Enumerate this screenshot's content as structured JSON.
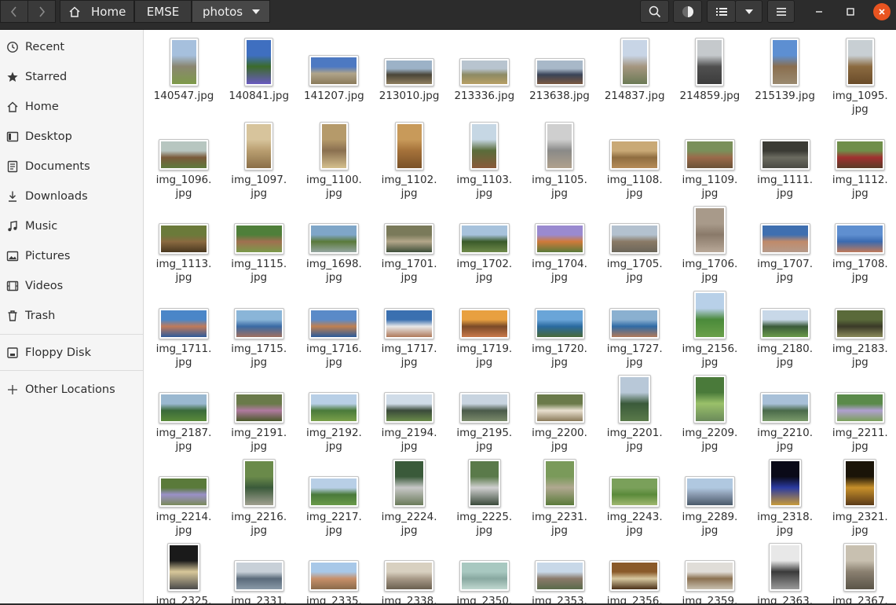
{
  "header": {
    "back_icon": "chevron-left-icon",
    "forward_icon": "chevron-right-icon",
    "breadcrumbs": [
      "Home",
      "EMSE",
      "photos"
    ],
    "buttons": [
      "search-icon",
      "progress-icon",
      "list-view-icon",
      "view-menu-caret-icon",
      "hamburger-menu-icon"
    ],
    "window_controls": [
      "minimize-icon",
      "maximize-icon",
      "close-icon"
    ],
    "close_color": "#e95420"
  },
  "sidebar": {
    "items": [
      {
        "label": "Recent",
        "icon": "clock-icon"
      },
      {
        "label": "Starred",
        "icon": "star-icon"
      },
      {
        "label": "Home",
        "icon": "home-icon"
      },
      {
        "label": "Desktop",
        "icon": "desktop-icon"
      },
      {
        "label": "Documents",
        "icon": "document-icon"
      },
      {
        "label": "Downloads",
        "icon": "download-icon"
      },
      {
        "label": "Music",
        "icon": "music-icon"
      },
      {
        "label": "Pictures",
        "icon": "pictures-icon"
      },
      {
        "label": "Videos",
        "icon": "video-icon"
      },
      {
        "label": "Trash",
        "icon": "trash-icon"
      },
      {
        "label": "Floppy Disk",
        "icon": "disk-icon"
      },
      {
        "label": "Other Locations",
        "icon": "plus-icon"
      }
    ]
  },
  "files": [
    {
      "name": "140547.jpg",
      "orient": "portrait",
      "colors": [
        "#a6c0dd",
        "#8a8670",
        "#7e9a4a"
      ]
    },
    {
      "name": "140841.jpg",
      "orient": "portrait",
      "colors": [
        "#3f6fc0",
        "#3b6b2a",
        "#6a5ac0"
      ]
    },
    {
      "name": "141207.jpg",
      "orient": "landscape",
      "colors": [
        "#4d79c2",
        "#b0a48a",
        "#8a7a5a"
      ]
    },
    {
      "name": "213010.jpg",
      "orient": "wide",
      "colors": [
        "#9cb2c7",
        "#4a4538",
        "#8f7e5f"
      ]
    },
    {
      "name": "213336.jpg",
      "orient": "wide",
      "colors": [
        "#b8c4cf",
        "#8d8a64",
        "#b8a065"
      ]
    },
    {
      "name": "213638.jpg",
      "orient": "wide",
      "colors": [
        "#a8b8c8",
        "#394357",
        "#7a5840"
      ]
    },
    {
      "name": "214837.jpg",
      "orient": "portrait",
      "colors": [
        "#c8d5e6",
        "#a59680",
        "#6b7a55"
      ]
    },
    {
      "name": "214859.jpg",
      "orient": "portrait",
      "colors": [
        "#c5c9cc",
        "#505050",
        "#3c3c3c"
      ]
    },
    {
      "name": "215139.jpg",
      "orient": "portrait",
      "colors": [
        "#5d8fd2",
        "#8a6e4e",
        "#9a8a70"
      ]
    },
    {
      "name": "img_1095.\njpg",
      "orient": "portrait",
      "colors": [
        "#c8cfd3",
        "#8b6a40",
        "#6a4c2a"
      ]
    },
    {
      "name": "img_1096.\njpg",
      "orient": "landscape",
      "colors": [
        "#b7c6c0",
        "#7a5a3a",
        "#5e7a3c"
      ]
    },
    {
      "name": "img_1097.\njpg",
      "orient": "portrait",
      "colors": [
        "#d7c49c",
        "#b99e70",
        "#8a6f48"
      ]
    },
    {
      "name": "img_1100.\njpg",
      "orient": "portrait",
      "colors": [
        "#b59a6a",
        "#8a7050",
        "#d4bf8d"
      ]
    },
    {
      "name": "img_1102.\njpg",
      "orient": "portrait",
      "colors": [
        "#c89a5a",
        "#a5723a",
        "#7a5228"
      ]
    },
    {
      "name": "img_1103.\njpg",
      "orient": "portrait",
      "colors": [
        "#c6d7e4",
        "#5a6c3a",
        "#8a5a3a"
      ]
    },
    {
      "name": "img_1105.\njpg",
      "orient": "portrait",
      "colors": [
        "#cfcfcf",
        "#8a8a88",
        "#b0a08c"
      ]
    },
    {
      "name": "img_1108.\njpg",
      "orient": "landscape",
      "colors": [
        "#c9a976",
        "#8f6d40",
        "#b68c58"
      ]
    },
    {
      "name": "img_1109.\njpg",
      "orient": "landscape",
      "colors": [
        "#7a8f5a",
        "#9a6a4a",
        "#6a5238"
      ]
    },
    {
      "name": "img_1111.\njpg",
      "orient": "landscape",
      "colors": [
        "#3a3a34",
        "#6b6b60",
        "#4a4a44"
      ]
    },
    {
      "name": "img_1112.\njpg",
      "orient": "landscape",
      "colors": [
        "#6f8e4a",
        "#a03030",
        "#5a3a28"
      ]
    },
    {
      "name": "img_1113.\njpg",
      "orient": "landscape",
      "colors": [
        "#6b7a3a",
        "#8a6a40",
        "#4a3820"
      ]
    },
    {
      "name": "img_1115.\njpg",
      "orient": "landscape",
      "colors": [
        "#4f7f3a",
        "#a07050",
        "#7a9a4a"
      ]
    },
    {
      "name": "img_1698.\njpg",
      "orient": "landscape",
      "colors": [
        "#7fa6c8",
        "#5a7a3a",
        "#94a5a0"
      ]
    },
    {
      "name": "img_1701.\njpg",
      "orient": "landscape",
      "colors": [
        "#7a7a5a",
        "#b4a78a",
        "#3f4f3a"
      ]
    },
    {
      "name": "img_1702.\njpg",
      "orient": "landscape",
      "colors": [
        "#a7c2dc",
        "#3a5a2a",
        "#6f8a4a"
      ]
    },
    {
      "name": "img_1704.\njpg",
      "orient": "landscape",
      "colors": [
        "#9a8ad0",
        "#d07a3a",
        "#5a7a3a"
      ]
    },
    {
      "name": "img_1705.\njpg",
      "orient": "landscape",
      "colors": [
        "#b3c1cf",
        "#8a7a66",
        "#6b665a"
      ]
    },
    {
      "name": "img_1706.\njpg",
      "orient": "portrait-tall",
      "colors": [
        "#a89a8a",
        "#8a7a6a",
        "#b8a898"
      ]
    },
    {
      "name": "img_1707.\njpg",
      "orient": "landscape",
      "colors": [
        "#3f6fb0",
        "#c08a6a",
        "#b59a8a"
      ]
    },
    {
      "name": "img_1708.\njpg",
      "orient": "landscape",
      "colors": [
        "#5f8fd0",
        "#3a6ab0",
        "#c07a5a"
      ]
    },
    {
      "name": "img_1711.\njpg",
      "orient": "landscape",
      "colors": [
        "#4a86c8",
        "#c07a5a",
        "#2f5a9a"
      ]
    },
    {
      "name": "img_1715.\njpg",
      "orient": "landscape",
      "colors": [
        "#8ab5d8",
        "#3a6aa5",
        "#a07060"
      ]
    },
    {
      "name": "img_1716.\njpg",
      "orient": "landscape",
      "colors": [
        "#5a8ac8",
        "#c08050",
        "#2a5a9a"
      ]
    },
    {
      "name": "img_1717.\njpg",
      "orient": "landscape",
      "colors": [
        "#3a70b0",
        "#e8e8e8",
        "#b07a5a"
      ]
    },
    {
      "name": "img_1719.\njpg",
      "orient": "landscape",
      "colors": [
        "#e8a040",
        "#7a4a28",
        "#c8784a"
      ]
    },
    {
      "name": "img_1720.\njpg",
      "orient": "landscape",
      "colors": [
        "#6aa5d8",
        "#2a6aa0",
        "#4a6a3a"
      ]
    },
    {
      "name": "img_1727.\njpg",
      "orient": "landscape",
      "colors": [
        "#8ab0d0",
        "#2f6aa5",
        "#b07a5a"
      ]
    },
    {
      "name": "img_2156.\njpg",
      "orient": "portrait-tall",
      "colors": [
        "#b8d0e8",
        "#4a8a3a",
        "#6aa04a"
      ]
    },
    {
      "name": "img_2180.\njpg",
      "orient": "landscape",
      "colors": [
        "#c8d8e8",
        "#3a5a3a",
        "#6a9a4a"
      ]
    },
    {
      "name": "img_2183.\njpg",
      "orient": "landscape",
      "colors": [
        "#5a6a3a",
        "#3a3a28",
        "#8a8a5a"
      ]
    },
    {
      "name": "img_2187.\njpg",
      "orient": "landscape",
      "colors": [
        "#9ab8d0",
        "#3a6a3a",
        "#5a8a3a"
      ]
    },
    {
      "name": "img_2191.\njpg",
      "orient": "landscape",
      "colors": [
        "#6a7a4a",
        "#b07aa0",
        "#4a5a2a"
      ]
    },
    {
      "name": "img_2192.\njpg",
      "orient": "landscape",
      "colors": [
        "#b8cfe6",
        "#4a7a3a",
        "#7aa04a"
      ]
    },
    {
      "name": "img_2194.\njpg",
      "orient": "landscape",
      "colors": [
        "#d0dce8",
        "#3a4a3a",
        "#6a8a4a"
      ]
    },
    {
      "name": "img_2195.\njpg",
      "orient": "landscape",
      "colors": [
        "#c8d4e0",
        "#4a5a4a",
        "#7a8a6a"
      ]
    },
    {
      "name": "img_2200.\njpg",
      "orient": "landscape",
      "colors": [
        "#6a7a4a",
        "#e8e0d0",
        "#8a7a5a"
      ]
    },
    {
      "name": "img_2201.\njpg",
      "orient": "portrait-tall",
      "colors": [
        "#b8c8d8",
        "#3a5a3a",
        "#5a7a4a"
      ]
    },
    {
      "name": "img_2209.\njpg",
      "orient": "portrait-tall",
      "colors": [
        "#4a7a3a",
        "#9ac06a",
        "#6a8a5a"
      ]
    },
    {
      "name": "img_2210.\njpg",
      "orient": "landscape",
      "colors": [
        "#a8c0d8",
        "#4a6a4a",
        "#7a9a6a"
      ]
    },
    {
      "name": "img_2211.\njpg",
      "orient": "landscape",
      "colors": [
        "#5a8a4a",
        "#b0a0d0",
        "#7aa05a"
      ]
    },
    {
      "name": "img_2214.\njpg",
      "orient": "landscape",
      "colors": [
        "#5a7a3a",
        "#9a90c8",
        "#7a8a5a"
      ]
    },
    {
      "name": "img_2216.\njpg",
      "orient": "portrait-tall",
      "colors": [
        "#6a8a4a",
        "#3a5a3a",
        "#a0a090"
      ]
    },
    {
      "name": "img_2217.\njpg",
      "orient": "landscape",
      "colors": [
        "#b8cfe6",
        "#4a7a3a",
        "#6a9a4a"
      ]
    },
    {
      "name": "img_2224.\njpg",
      "orient": "portrait-tall",
      "colors": [
        "#3a5a3a",
        "#c8c8c8",
        "#6a7a5a"
      ]
    },
    {
      "name": "img_2225.\njpg",
      "orient": "portrait-tall",
      "colors": [
        "#5a7a4a",
        "#d0d0d0",
        "#3a4a3a"
      ]
    },
    {
      "name": "img_2231.\njpg",
      "orient": "portrait-tall",
      "colors": [
        "#7a9a5a",
        "#b0a890",
        "#5a7a3a"
      ]
    },
    {
      "name": "img_2243.\njpg",
      "orient": "landscape",
      "colors": [
        "#7aa05a",
        "#5a8a3a",
        "#a0b870"
      ]
    },
    {
      "name": "img_2289.\njpg",
      "orient": "landscape",
      "colors": [
        "#b0c8e0",
        "#8a9ab0",
        "#4a5a6a"
      ]
    },
    {
      "name": "img_2318.\njpg",
      "orient": "portrait-tall",
      "colors": [
        "#0a0a18",
        "#2a3aa0",
        "#c89a3a"
      ]
    },
    {
      "name": "img_2321.\njpg",
      "orient": "portrait-tall",
      "colors": [
        "#1a1408",
        "#c8902a",
        "#5a3a18"
      ]
    },
    {
      "name": "img_2325.",
      "orient": "portrait-tall",
      "colors": [
        "#1a1a1a",
        "#d8c89a",
        "#4a4a4a"
      ]
    },
    {
      "name": "img_2331.",
      "orient": "landscape",
      "colors": [
        "#c8d0d8",
        "#5a6a7a",
        "#8a9aa8"
      ]
    },
    {
      "name": "img_2335.",
      "orient": "landscape",
      "colors": [
        "#a8c8e8",
        "#c8906a",
        "#8a6a4a"
      ]
    },
    {
      "name": "img_2338.",
      "orient": "landscape",
      "colors": [
        "#d8d0c0",
        "#a89a88",
        "#6a6050"
      ]
    },
    {
      "name": "img_2350.",
      "orient": "landscape",
      "colors": [
        "#a8c8c0",
        "#88a8a0",
        "#c0d8d0"
      ]
    },
    {
      "name": "img_2353.",
      "orient": "landscape",
      "colors": [
        "#c8d8e8",
        "#8a7a6a",
        "#5a6a4a"
      ]
    },
    {
      "name": "img_2356.",
      "orient": "landscape",
      "colors": [
        "#8a5a2a",
        "#d8c8a0",
        "#4a3018"
      ]
    },
    {
      "name": "img_2359.",
      "orient": "landscape",
      "colors": [
        "#e0ddd8",
        "#8a7050",
        "#c8c0b0"
      ]
    },
    {
      "name": "img_2363.",
      "orient": "portrait-tall",
      "colors": [
        "#e8e8e8",
        "#3a3a3a",
        "#9a9a9a"
      ]
    },
    {
      "name": "img_2367.",
      "orient": "portrait-tall",
      "colors": [
        "#c8c0b0",
        "#8a8070",
        "#5a5448"
      ]
    }
  ]
}
